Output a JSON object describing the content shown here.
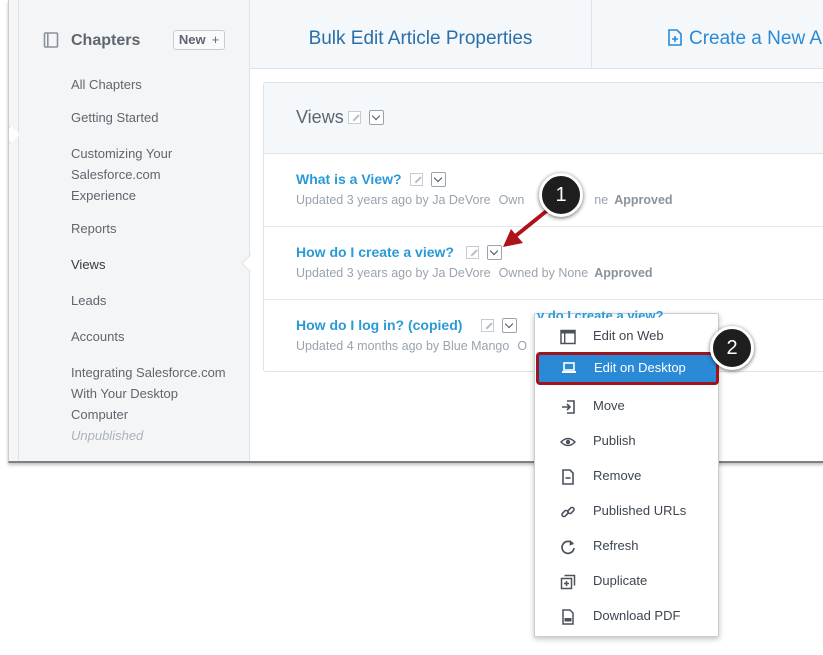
{
  "sidebar": {
    "title": "Chapters",
    "new_button": "New",
    "new_plus": "+",
    "items": [
      {
        "label": "All Chapters"
      },
      {
        "label": "Getting Started"
      },
      {
        "label": "Customizing Your Salesforce.com Experience"
      },
      {
        "label": "Reports"
      },
      {
        "label": "Views"
      },
      {
        "label": "Leads"
      },
      {
        "label": "Accounts"
      },
      {
        "label": "Integrating Salesforce.com With Your Desktop Computer",
        "badge": "Unpublished"
      }
    ],
    "active_item": "Views"
  },
  "tabs": {
    "bulk_edit": "Bulk Edit Article Properties",
    "create_new": "Create a New Ar"
  },
  "section": {
    "title": "Views"
  },
  "articles": [
    {
      "title": "What is a View?",
      "meta": "Updated 3 years ago by Ja DeVore",
      "owner": "Owned by None",
      "status": "Approved"
    },
    {
      "title": "How do I create a view?",
      "meta": "Updated 3 years ago by Ja DeVore",
      "owner": "Owned by None",
      "status": "Approved"
    },
    {
      "title": "How do I log in? (copied)",
      "meta": "Updated 4 months ago by Blue Mango",
      "owner": "O"
    }
  ],
  "article0_owner_fragment": "Own",
  "article0_owner_tail": "ne",
  "menu": {
    "peek_title": "v do I create a view?",
    "items": [
      {
        "label": "Edit on Web",
        "icon": "browser-window-icon"
      },
      {
        "label": "Edit on Desktop",
        "icon": "laptop-icon"
      },
      {
        "label": "Move",
        "icon": "move-in-icon"
      },
      {
        "label": "Publish",
        "icon": "eye-icon"
      },
      {
        "label": "Remove",
        "icon": "document-minus-icon"
      },
      {
        "label": "Published URLs",
        "icon": "link-icon"
      },
      {
        "label": "Refresh",
        "icon": "refresh-icon"
      },
      {
        "label": "Duplicate",
        "icon": "duplicate-icon"
      },
      {
        "label": "Download PDF",
        "icon": "pdf-icon"
      }
    ],
    "highlighted": "Edit on Desktop"
  },
  "menu_trunc": "a",
  "callouts": [
    "1",
    "2"
  ],
  "colors": {
    "link": "#2a9ad6",
    "highlight": "#2a8ad6",
    "highlight_border": "#a0151d",
    "arrow": "#b0121a"
  }
}
